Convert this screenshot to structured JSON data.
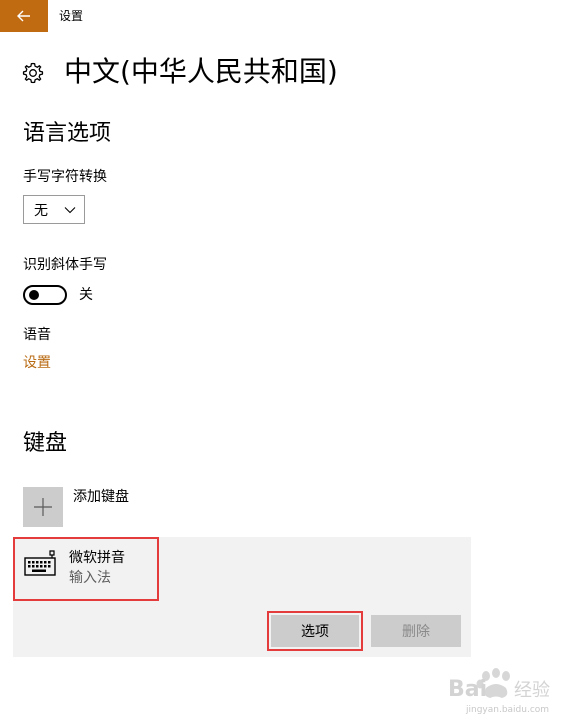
{
  "app": {
    "title": "设置",
    "accent_color": "#c06a12"
  },
  "header": {
    "title": "中文(中华人民共和国)",
    "icon": "gear-icon"
  },
  "language_options": {
    "section_title": "语言选项",
    "handwriting": {
      "label": "手写字符转换",
      "selected": "无"
    },
    "italic_handwriting": {
      "label": "识别斜体手写",
      "state": "关",
      "on": false
    },
    "speech": {
      "label": "语音",
      "link": "设置",
      "link_color": "#b86a12"
    }
  },
  "keyboard": {
    "section_title": "键盘",
    "add_label": "添加键盘",
    "items": [
      {
        "name": "微软拼音",
        "type": "输入法",
        "icon": "keyboard-icon"
      }
    ],
    "options_button": "选项",
    "delete_button": "删除",
    "highlight_color": "#e43c3c"
  },
  "watermark": {
    "logo": "Baidu经验",
    "url": "jingyan.baidu.com"
  }
}
